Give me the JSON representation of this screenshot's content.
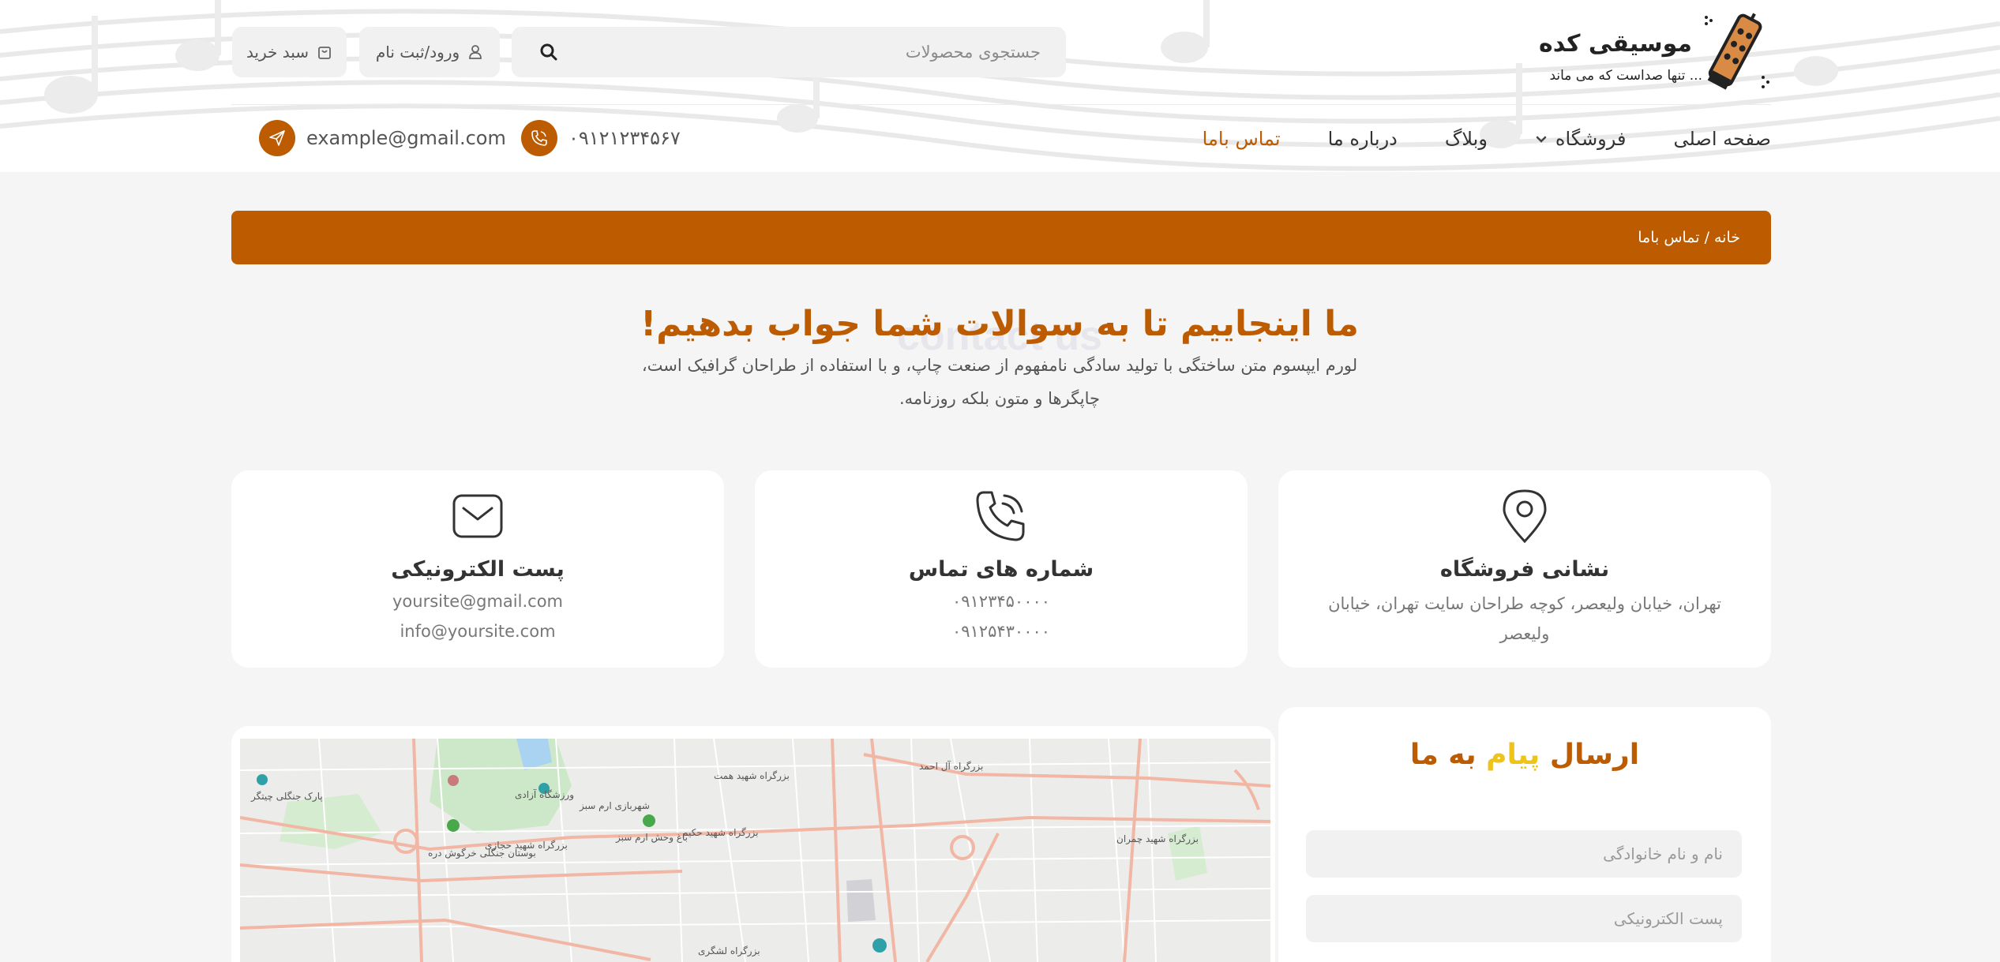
{
  "brand": {
    "name": "موسیقی کده",
    "tagline": "تنها صداست که می ماند ..."
  },
  "search": {
    "placeholder": "جستجوی محصولات",
    "icon": "search-icon"
  },
  "header_buttons": {
    "login_label": "ورود/ثبت نام",
    "cart_label": "سبد خرید"
  },
  "nav": {
    "items": [
      {
        "label": "صفحه اصلی",
        "active": false
      },
      {
        "label": "فروشگاه",
        "active": false,
        "has_dropdown": true
      },
      {
        "label": "وبلاگ",
        "active": false
      },
      {
        "label": "درباره ما",
        "active": false
      },
      {
        "label": "تماس باما",
        "active": true
      }
    ]
  },
  "header_contact": {
    "phone": "۰۹۱۲۱۲۳۴۵۶۷",
    "email": "example@gmail.com"
  },
  "breadcrumb": {
    "home": "خانه",
    "separator": "/",
    "current": "تماس باما"
  },
  "hero": {
    "watermark": "contact us",
    "title": "ما اینجاییم تا به سوالات شما جواب بدهیم!",
    "description_line1": "لورم ایپسوم متن ساختگی با تولید سادگی نامفهوم از صنعت چاپ، و با استفاده از طراحان گرافیک است،",
    "description_line2": "چاپگرها و متون بلکه روزنامه."
  },
  "cards": {
    "address": {
      "title": "نشانی فروشگاه",
      "text": "تهران، خیابان ولیعصر، کوچه طراحان سایت تهران، خیابان ولیعصر",
      "icon": "location-pin-icon"
    },
    "phones": {
      "title": "شماره های تماس",
      "line1": "۰۹۱۲۳۴۵۰۰۰۰",
      "line2": "۰۹۱۲۵۴۳۰۰۰۰",
      "icon": "phone-icon"
    },
    "email": {
      "title": "پست الکترونیکی",
      "line1": "yoursite@gmail.com",
      "line2": "info@yoursite.com",
      "icon": "envelope-icon"
    }
  },
  "map": {
    "labels": [
      "پارک جنگلی چیتگر",
      "ورزشگاه آزادی",
      "شهربازی ارم سبز",
      "باغ وحش ارم سبز",
      "بزرگراه شهید حکیم",
      "بوستان جنگلی خرگوش دره",
      "بزرگراه لشگری",
      "بزرگراه آل احمد",
      "بزرگراه شهید چمران",
      "بزرگراه شهید همت",
      "بزرگراه شهید حجازی"
    ]
  },
  "form": {
    "title_part1": "ارسال",
    "title_part2": "پیام",
    "title_part3": "به ما",
    "name_placeholder": "نام و نام خانوادگی",
    "email_placeholder": "پست الکترونیکی"
  },
  "colors": {
    "accent": "#bd5b00",
    "highlight": "#efc41a",
    "background": "#f5f5f5"
  }
}
